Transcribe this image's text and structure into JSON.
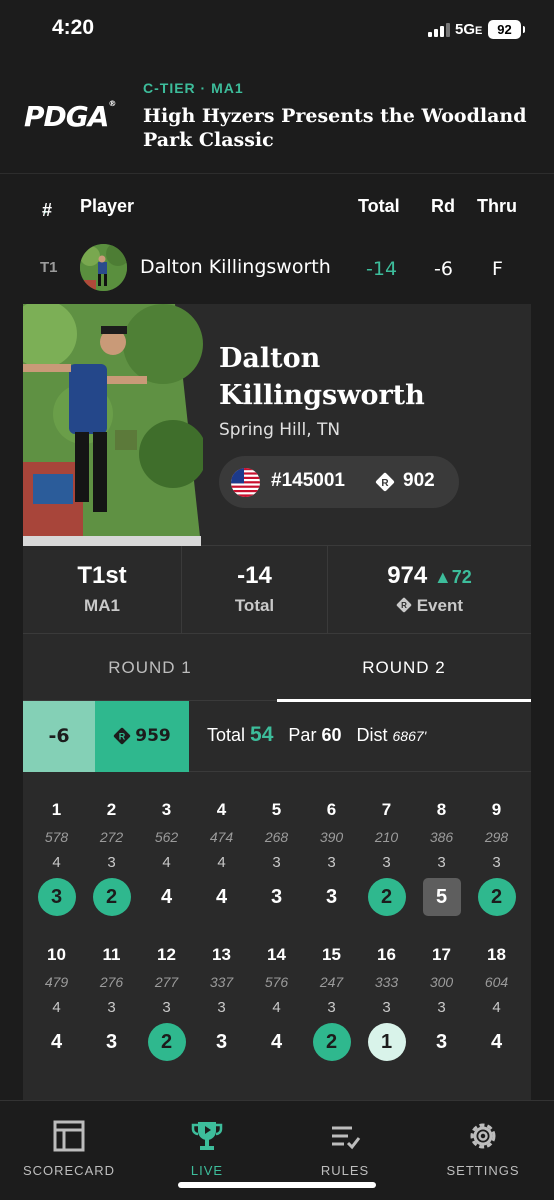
{
  "status": {
    "time": "4:20",
    "network": "5G",
    "network_suffix": "E",
    "battery": "92"
  },
  "header": {
    "logo": "PDGA",
    "tier": "C-TIER · MA1",
    "event_title": "High Hyzers Presents the Woodland Park Classic"
  },
  "columns": {
    "sort_icon": "↓",
    "pos": "#",
    "player": "Player",
    "total": "Total",
    "round": "Rd",
    "thru": "Thru"
  },
  "row": {
    "pos": "T1",
    "name": "Dalton Killingsworth",
    "total": "-14",
    "round": "-6",
    "thru": "F"
  },
  "player_card": {
    "first_name": "Dalton",
    "last_name": "Killingsworth",
    "location": "Spring Hill, TN",
    "pdga_number": "#145001",
    "rating": "902",
    "stats": {
      "place": "T1st",
      "division": "MA1",
      "total": "-14",
      "total_label": "Total",
      "event_rating": "974",
      "rating_change": "72",
      "event_label": "Event"
    }
  },
  "tabs": [
    "ROUND 1",
    "ROUND 2"
  ],
  "active_tab": 1,
  "round": {
    "score": "-6",
    "round_rating": "959",
    "total_label": "Total",
    "total": "54",
    "par_label": "Par",
    "par": "60",
    "dist_label": "Dist",
    "dist": "6867'"
  },
  "holes": [
    {
      "num": "1",
      "dist": "578",
      "par": "4",
      "score": "3",
      "type": "birdie"
    },
    {
      "num": "2",
      "dist": "272",
      "par": "3",
      "score": "2",
      "type": "birdie"
    },
    {
      "num": "3",
      "dist": "562",
      "par": "4",
      "score": "4",
      "type": "par"
    },
    {
      "num": "4",
      "dist": "474",
      "par": "4",
      "score": "4",
      "type": "par"
    },
    {
      "num": "5",
      "dist": "268",
      "par": "3",
      "score": "3",
      "type": "par"
    },
    {
      "num": "6",
      "dist": "390",
      "par": "3",
      "score": "3",
      "type": "par"
    },
    {
      "num": "7",
      "dist": "210",
      "par": "3",
      "score": "2",
      "type": "birdie"
    },
    {
      "num": "8",
      "dist": "386",
      "par": "3",
      "score": "5",
      "type": "bogey"
    },
    {
      "num": "9",
      "dist": "298",
      "par": "3",
      "score": "2",
      "type": "birdie"
    },
    {
      "num": "10",
      "dist": "479",
      "par": "4",
      "score": "4",
      "type": "par"
    },
    {
      "num": "11",
      "dist": "276",
      "par": "3",
      "score": "3",
      "type": "par"
    },
    {
      "num": "12",
      "dist": "277",
      "par": "3",
      "score": "2",
      "type": "birdie"
    },
    {
      "num": "13",
      "dist": "337",
      "par": "3",
      "score": "3",
      "type": "par"
    },
    {
      "num": "14",
      "dist": "576",
      "par": "4",
      "score": "4",
      "type": "par"
    },
    {
      "num": "15",
      "dist": "247",
      "par": "3",
      "score": "2",
      "type": "birdie"
    },
    {
      "num": "16",
      "dist": "333",
      "par": "3",
      "score": "1",
      "type": "ace"
    },
    {
      "num": "17",
      "dist": "300",
      "par": "3",
      "score": "3",
      "type": "par"
    },
    {
      "num": "18",
      "dist": "604",
      "par": "4",
      "score": "4",
      "type": "par"
    }
  ],
  "nav": [
    {
      "label": "SCORECARD",
      "icon": "scorecard-icon"
    },
    {
      "label": "LIVE",
      "icon": "trophy-icon",
      "active": true
    },
    {
      "label": "RULES",
      "icon": "rules-icon"
    },
    {
      "label": "SETTINGS",
      "icon": "gear-icon"
    }
  ],
  "colors": {
    "accent": "#3dbd9b",
    "birdie": "#2fb88e",
    "ace": "#d9f3ea",
    "bogey": "#5e5e5e",
    "background": "#1c1c1c",
    "card": "#2a2a2a"
  }
}
